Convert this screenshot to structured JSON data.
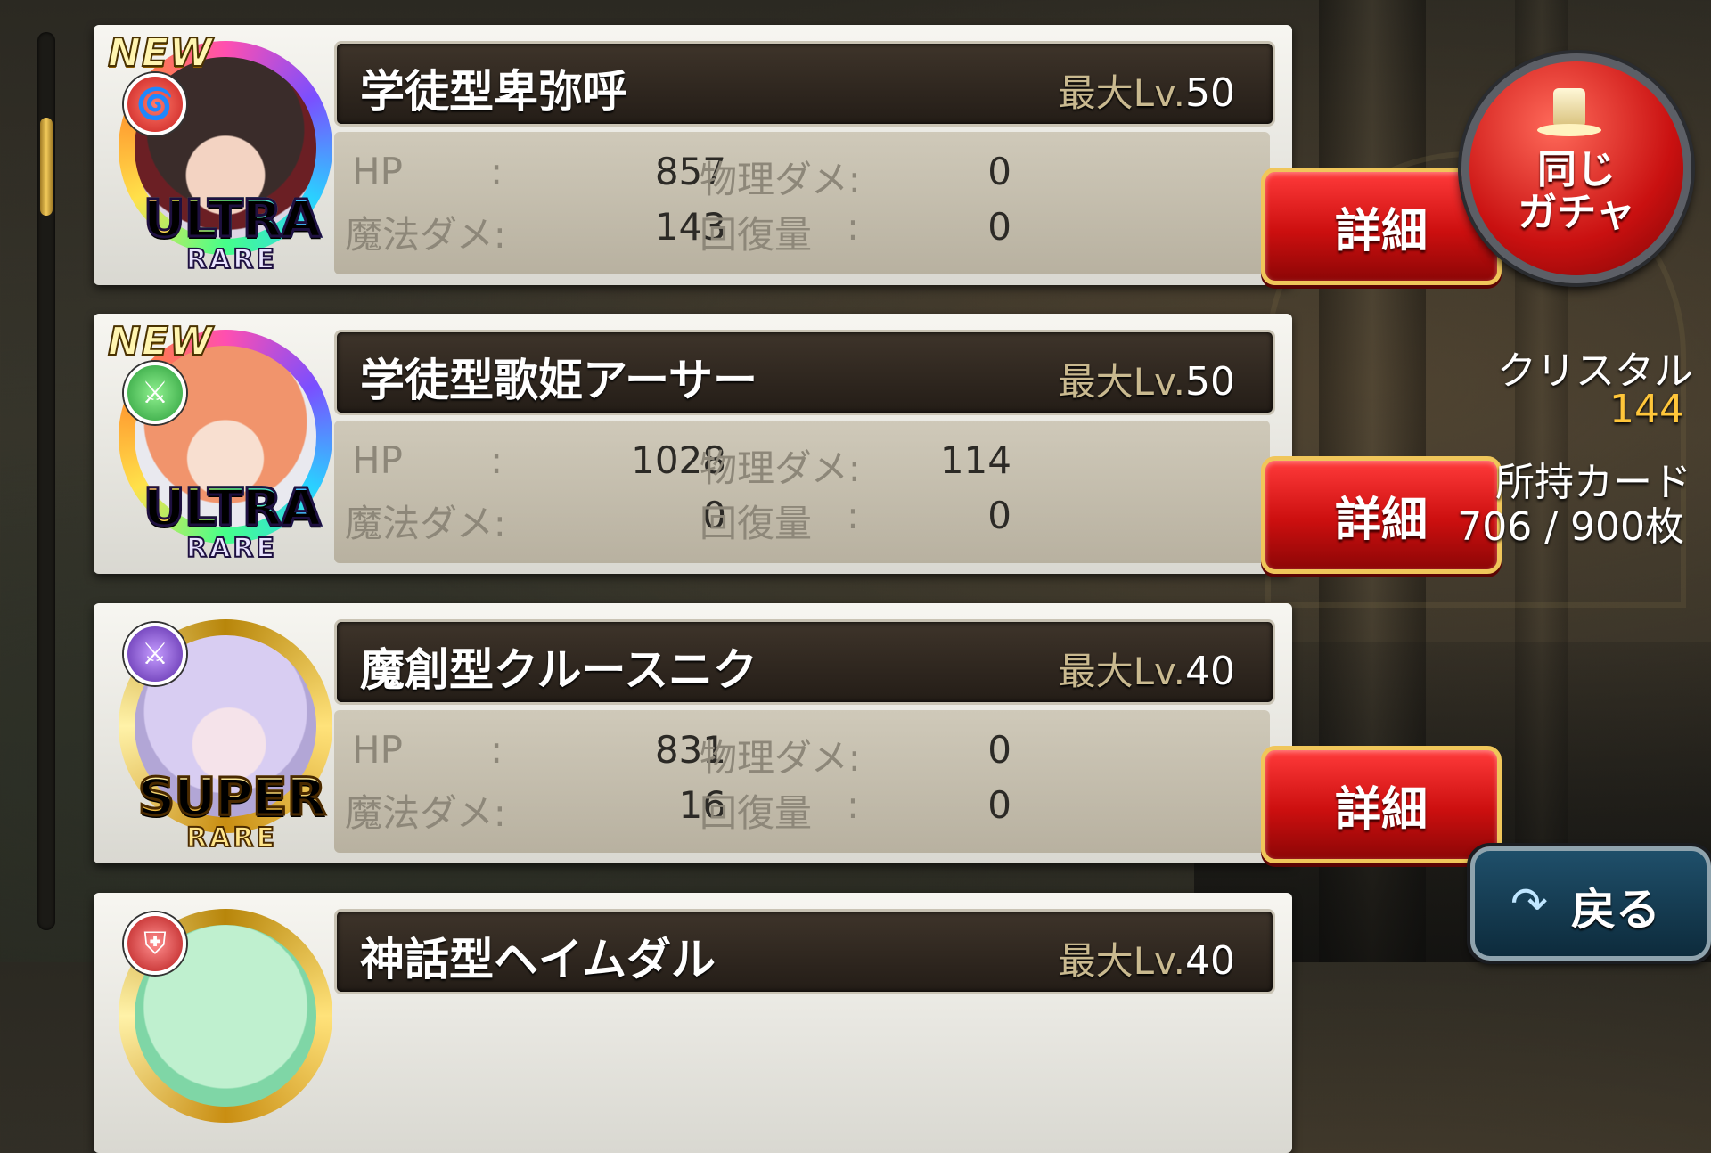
{
  "cards": [
    {
      "name": "学徒型卑弥呼",
      "max_lv_label": "最大Lv.",
      "max_lv": "50",
      "new": "NEW",
      "rarity_main": "ULTRA",
      "rarity_sub": "RARE",
      "element_icon": "spiral-icon",
      "hp_label": "HP",
      "hp": "857",
      "phys_label": "物理ダメ",
      "phys": "0",
      "mag_label": "魔法ダメ",
      "mag": "143",
      "heal_label": "回復量",
      "heal": "0",
      "detail_label": "詳細"
    },
    {
      "name": "学徒型歌姫アーサー",
      "max_lv_label": "最大Lv.",
      "max_lv": "50",
      "new": "NEW",
      "rarity_main": "ULTRA",
      "rarity_sub": "RARE",
      "element_icon": "crossed-swords-icon",
      "hp_label": "HP",
      "hp": "1028",
      "phys_label": "物理ダメ",
      "phys": "114",
      "mag_label": "魔法ダメ",
      "mag": "0",
      "heal_label": "回復量",
      "heal": "0",
      "detail_label": "詳細"
    },
    {
      "name": "魔創型クルースニク",
      "max_lv_label": "最大Lv.",
      "max_lv": "40",
      "new": "",
      "rarity_main": "SUPER",
      "rarity_sub": "RARE",
      "element_icon": "crossed-swords-icon",
      "hp_label": "HP",
      "hp": "831",
      "phys_label": "物理ダメ",
      "phys": "0",
      "mag_label": "魔法ダメ",
      "mag": "16",
      "heal_label": "回復量",
      "heal": "0",
      "detail_label": "詳細"
    },
    {
      "name": "神話型ヘイムダル",
      "max_lv_label": "最大Lv.",
      "max_lv": "40",
      "element_icon": "shield-icon"
    }
  ],
  "sidebar": {
    "same_gacha_label_1": "同じ",
    "same_gacha_label_2": "ガチャ",
    "crystal_label": "クリスタル",
    "crystal_value": "144",
    "owned_cards_label": "所持カード",
    "owned_cards_value": "706 / 900枚",
    "back_label": "戻る"
  },
  "colors": {
    "detail_button": "#cc0f0f",
    "crystal_value": "#ffc63a"
  }
}
